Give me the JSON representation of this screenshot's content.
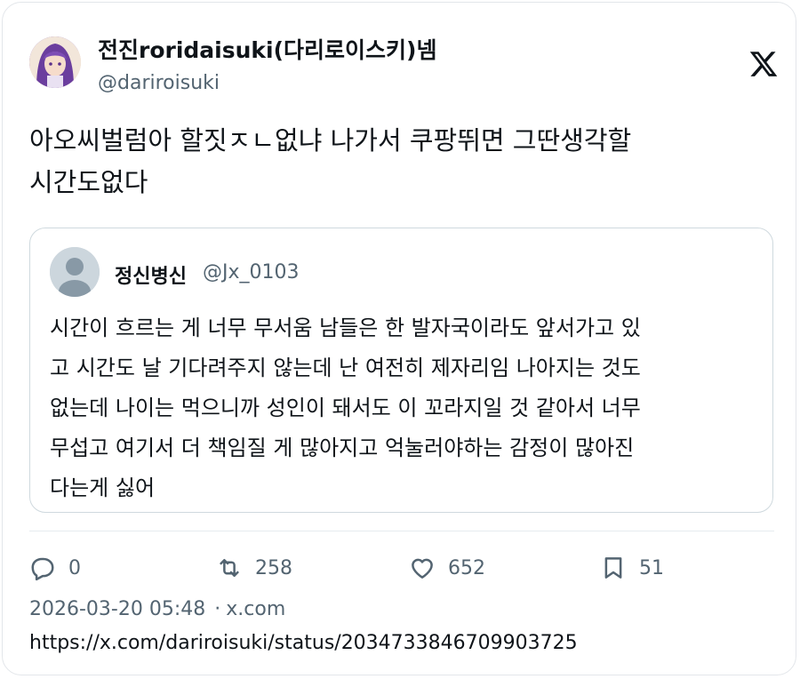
{
  "tweet": {
    "display_name": "전진roridaisuki(다리로이스키)넴",
    "handle": "@dariroisuki",
    "text_line1": "아오씨벌럼아 할짓ㅈㄴ없냐 나가서 쿠팡뛰면 그딴생각할",
    "text_line2": "시간도없다"
  },
  "quote": {
    "display_name": "정신병신",
    "handle": "@Jx_0103",
    "lines": [
      "시간이 흐르는 게 너무 무서움  남들은 한 발자국이라도 앞서가고 있",
      "고 시간도 날 기다려주지 않는데 난 여전히 제자리임 나아지는 것도",
      "없는데 나이는 먹으니까 성인이 돼서도 이 꼬라지일 것 같아서 너무",
      "무섭고 여기서 더 책임질 게 많아지고 억눌러야하는 감정이 많아진",
      "다는게 싫어"
    ]
  },
  "actions": {
    "replies": "0",
    "retweets": "258",
    "likes": "652",
    "bookmarks": "51"
  },
  "meta": {
    "timestamp": "2026-03-20 05:48",
    "separator": "·",
    "source": "x.com",
    "url": "https://x.com/dariroisuki/status/2034733846709903725"
  },
  "icons": {
    "brand": "x-logo-icon",
    "reply": "reply-icon",
    "retweet": "retweet-icon",
    "like": "heart-icon",
    "bookmark": "bookmark-icon"
  },
  "colors": {
    "text": "#0f1419",
    "secondary": "#536471",
    "border": "#cfd9de"
  }
}
